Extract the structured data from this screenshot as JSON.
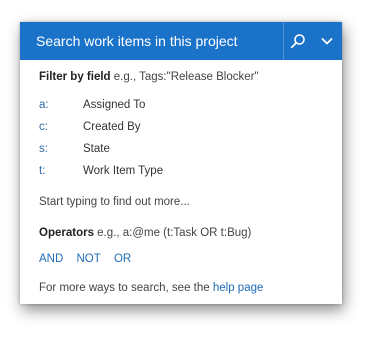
{
  "search": {
    "placeholder": "Search work items in this project",
    "search_button": "search-icon",
    "dropdown_button": "chevron-down-icon"
  },
  "filter": {
    "heading": "Filter by field",
    "example": "e.g., Tags:\"Release Blocker\"",
    "fields": [
      {
        "key": "a:",
        "name": "Assigned To"
      },
      {
        "key": "c:",
        "name": "Created By"
      },
      {
        "key": "s:",
        "name": "State"
      },
      {
        "key": "t:",
        "name": "Work Item Type"
      }
    ]
  },
  "hint": "Start typing to find out more...",
  "operators": {
    "heading": "Operators",
    "example": "e.g., a:@me (t:Task OR t:Bug)",
    "items": [
      "AND",
      "NOT",
      "OR"
    ]
  },
  "footer": {
    "text": "For more ways to search, see the",
    "link": "help page"
  },
  "colors": {
    "accent": "#1a73c9",
    "link": "#1f6bb8"
  }
}
